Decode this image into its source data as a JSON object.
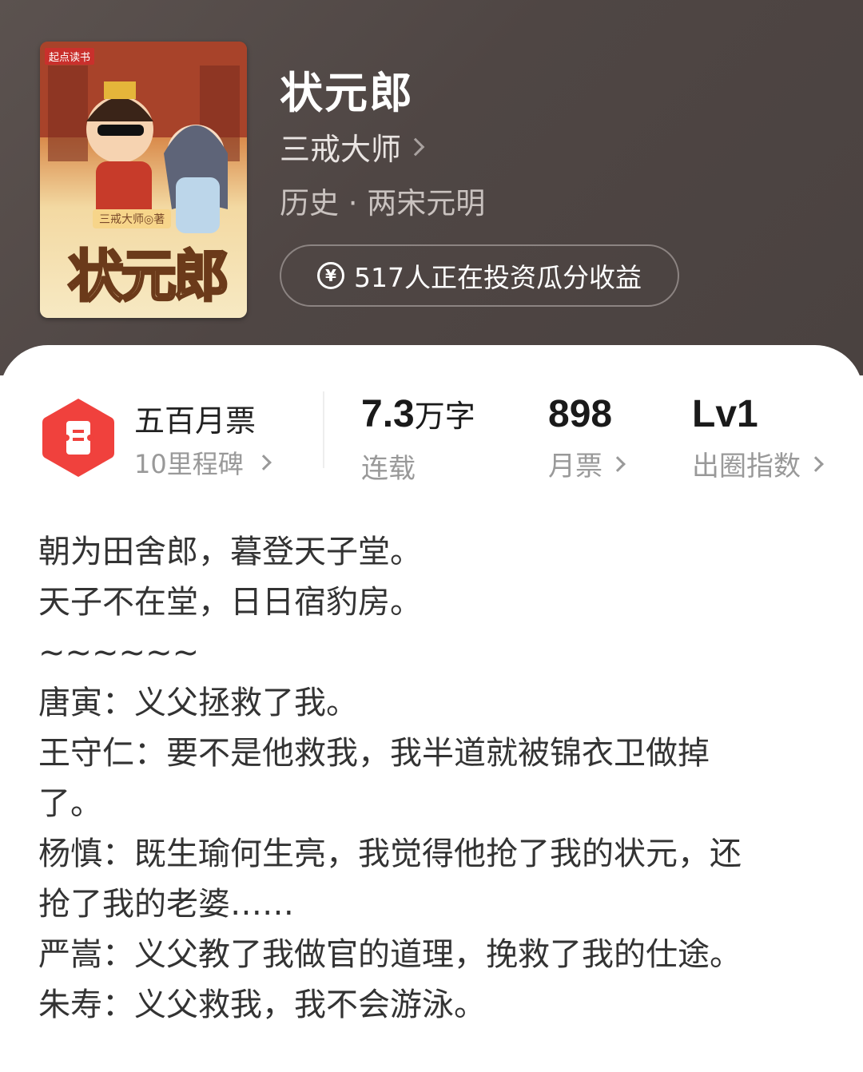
{
  "book": {
    "cover_publisher": "起点读书",
    "cover_author_tag": "三戒大师◎著",
    "cover_title": "状元郎",
    "title": "状元郎",
    "author": "三戒大师",
    "category": "历史 · 两宋元明",
    "invest_text": "517人正在投资瓜分收益"
  },
  "stats": {
    "ticket_title": "五百月票",
    "ticket_sub": "10里程碑",
    "words_value": "7.3",
    "words_unit": "万字",
    "words_label": "连载",
    "monthly_value": "898",
    "monthly_label": "月票",
    "level_value": "Lv1",
    "level_label": "出圈指数"
  },
  "description": [
    "朝为田舍郎，暮登天子堂。",
    "天子不在堂，日日宿豹房。",
    "~~~~~~",
    "唐寅：义父拯救了我。",
    "王守仁：要不是他救我，我半道就被锦衣卫做掉",
    "了。",
    "杨慎：既生瑜何生亮，我觉得他抢了我的状元，还",
    "抢了我的老婆……",
    "严嵩：义父教了我做官的道理，挽救了我的仕途。",
    "朱寿：义父救我，我不会游泳。"
  ],
  "colors": {
    "header_bg": "#4f4644",
    "badge_red": "#f0413d",
    "text_dark": "#333333",
    "text_gray": "#999999"
  },
  "icons": [
    "yen-icon",
    "ticket-icon",
    "chevron-right-icon"
  ]
}
